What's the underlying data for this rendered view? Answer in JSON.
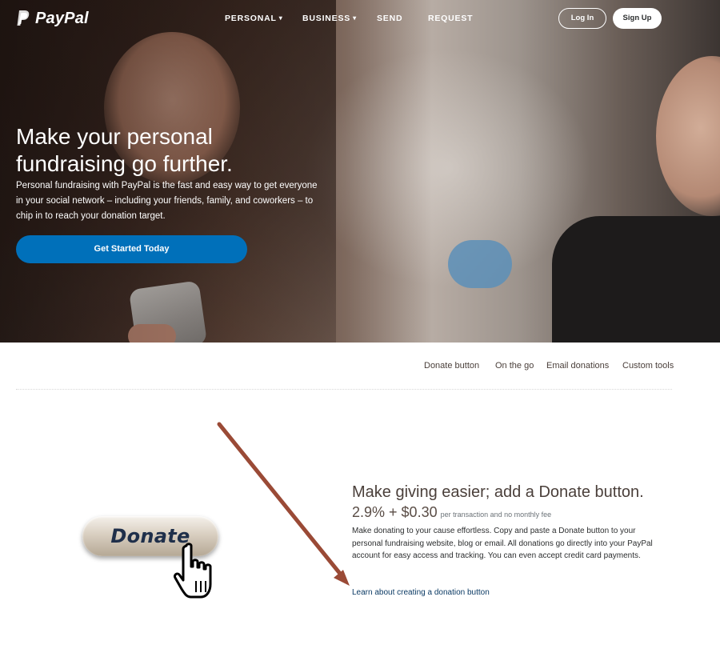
{
  "brand": {
    "name": "PayPal"
  },
  "nav": {
    "items": [
      {
        "label": "PERSONAL",
        "dropdown": true
      },
      {
        "label": "BUSINESS",
        "dropdown": true
      },
      {
        "label": "SEND",
        "dropdown": false
      },
      {
        "label": "REQUEST",
        "dropdown": false
      }
    ],
    "login_label": "Log In",
    "signup_label": "Sign Up"
  },
  "hero": {
    "title": "Make your personal fundraising go further.",
    "subtitle": "Personal fundraising with PayPal is the fast and easy way to get everyone in your social network – including your friends, family, and coworkers – to chip in to reach your donation target.",
    "cta_label": "Get Started Today"
  },
  "subnav": {
    "items": [
      "Donate button",
      "On the go",
      "Email donations",
      "Custom tools"
    ]
  },
  "feature": {
    "title": "Make giving easier; add a Donate button.",
    "price": "2.9% + $0.30",
    "price_note": "per transaction and no monthly fee",
    "description": "Make donating to your cause effortless. Copy and paste a Donate button to your personal fundraising website, blog or email. All donations go directly into your PayPal account for easy access and tracking. You can even accept credit card payments.",
    "link_label": "Learn about creating a donation button",
    "donate_button_label": "Donate"
  },
  "colors": {
    "brand_blue": "#0070ba",
    "link": "#0b3a64",
    "arrow": "#9a4a36"
  },
  "icons": {
    "logo": "paypal-p-icon",
    "cursor": "hand-pointer-icon",
    "dropdown": "chevron-down-icon"
  }
}
